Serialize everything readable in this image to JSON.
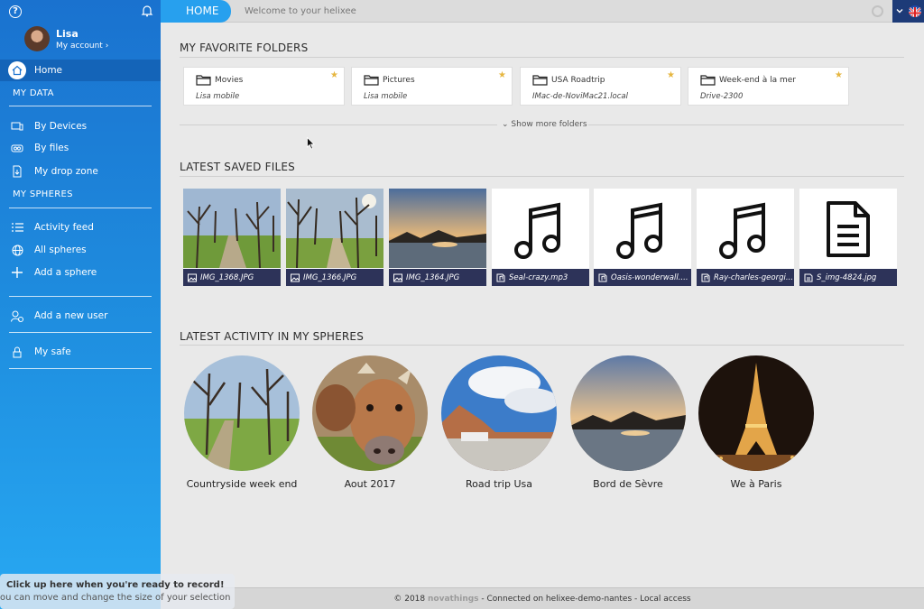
{
  "sidebar": {
    "user_name": "Lisa",
    "my_account": "My account",
    "home": "Home",
    "section_data": "MY DATA",
    "by_devices": "By Devices",
    "by_files": "By files",
    "drop_zone": "My drop zone",
    "section_spheres": "MY SPHERES",
    "activity_feed": "Activity feed",
    "all_spheres": "All spheres",
    "add_sphere": "Add a sphere",
    "add_user": "Add a new user",
    "my_safe": "My safe"
  },
  "topbar": {
    "home_tab": "HOME",
    "welcome": "Welcome to your helixee"
  },
  "favorites": {
    "title": "MY FAVORITE FOLDERS",
    "show_more": "Show more folders",
    "folders": [
      {
        "name": "Movies",
        "device": "Lisa mobile"
      },
      {
        "name": "Pictures",
        "device": "Lisa mobile"
      },
      {
        "name": "USA Roadtrip",
        "device": "IMac-de-NoviMac21.local"
      },
      {
        "name": "Week-end à la mer",
        "device": "Drive-2300"
      }
    ]
  },
  "files": {
    "title": "LATEST SAVED FILES",
    "items": [
      {
        "name": "IMG_1368.JPG",
        "kind": "image"
      },
      {
        "name": "IMG_1366.JPG",
        "kind": "image"
      },
      {
        "name": "IMG_1364.JPG",
        "kind": "image"
      },
      {
        "name": "Seal-crazy.mp3",
        "kind": "audio"
      },
      {
        "name": "Oasis-wonderwall....",
        "kind": "audio"
      },
      {
        "name": "Ray-charles-georgi...",
        "kind": "audio"
      },
      {
        "name": "S_img-4824.jpg",
        "kind": "document"
      }
    ]
  },
  "activity": {
    "title": "LATEST ACTIVITY IN MY SPHERES",
    "spheres": [
      {
        "name": "Countryside week end"
      },
      {
        "name": "Aout 2017"
      },
      {
        "name": "Road trip Usa"
      },
      {
        "name": "Bord de Sèvre"
      },
      {
        "name": "We à Paris"
      }
    ]
  },
  "footer": {
    "copyright": "© 2018",
    "brand": "novathings",
    "status": "- Connected on helixee-demo-nantes - Local access"
  },
  "record_overlay": {
    "line1": "Click up here when you're ready to record!",
    "line2": "ou can move and change the size of your selection"
  },
  "colors": {
    "sidebar_top": "#1a72cf",
    "sidebar_bottom": "#27a8f2",
    "home_tab": "#27a0ee",
    "file_bar": "#2d3359",
    "star": "#e6b640"
  }
}
